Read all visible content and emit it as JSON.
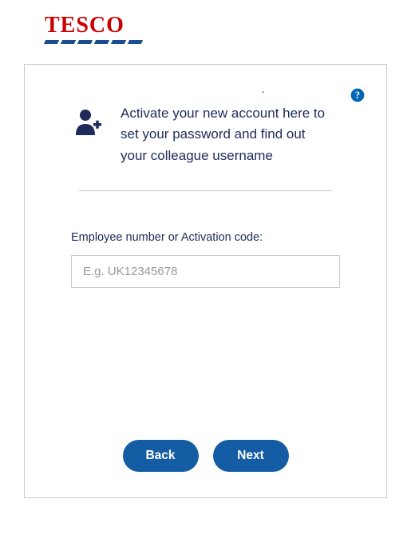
{
  "logo": {
    "text": "TESCO"
  },
  "header": {
    "instruction": "Activate your new account here to set your password and find out your colleague username"
  },
  "form": {
    "label": "Employee number or Activation code:",
    "placeholder": "E.g. UK12345678",
    "value": ""
  },
  "buttons": {
    "back": "Back",
    "next": "Next"
  },
  "colors": {
    "brand_red": "#cc0000",
    "brand_blue": "#1a4e8e",
    "text_navy": "#1e2b5a",
    "button_blue": "#145ca3"
  }
}
